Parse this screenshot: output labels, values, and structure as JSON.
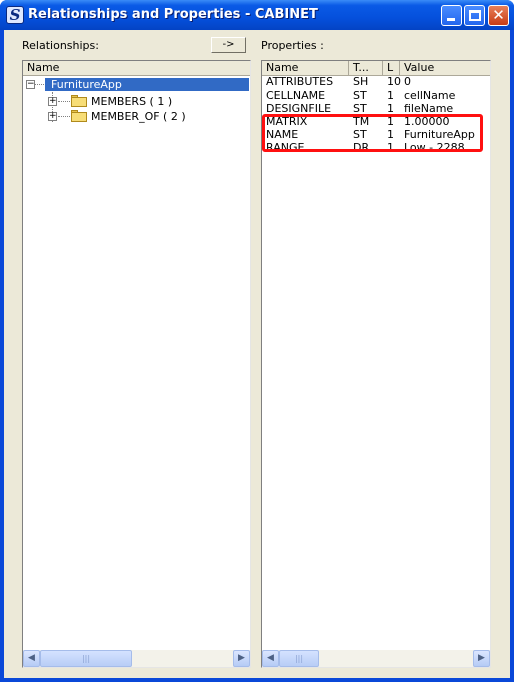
{
  "window": {
    "title": "Relationships and Properties - CABINET",
    "icon": "app-s-icon"
  },
  "relationships": {
    "label": "Relationships:",
    "arrow_button": "->",
    "column_header": "Name",
    "tree": {
      "root": "FurnitureApp",
      "children": [
        "MEMBERS ( 1 )",
        "MEMBER_OF ( 2 )"
      ]
    }
  },
  "properties": {
    "label": "Properties :",
    "columns": [
      "Name",
      "T...",
      "L",
      "Value"
    ],
    "rows": [
      {
        "name": "ATTRIBUTES",
        "type": "SH",
        "len": "10",
        "value": "0"
      },
      {
        "name": "CELLNAME",
        "type": "ST",
        "len": "1",
        "value": "cellName"
      },
      {
        "name": "DESIGNFILE",
        "type": "ST",
        "len": "1",
        "value": "fileName"
      },
      {
        "name": "MATRIX",
        "type": "TM",
        "len": "1",
        "value": "1.00000"
      },
      {
        "name": "NAME",
        "type": "ST",
        "len": "1",
        "value": "FurnitureApp"
      },
      {
        "name": "RANGE",
        "type": "DR",
        "len": "1",
        "value": "Low  -    2288."
      }
    ]
  },
  "colors": {
    "title_bar": "#0550dc",
    "selection": "#316ac5",
    "highlight_box": "#ff1010"
  }
}
